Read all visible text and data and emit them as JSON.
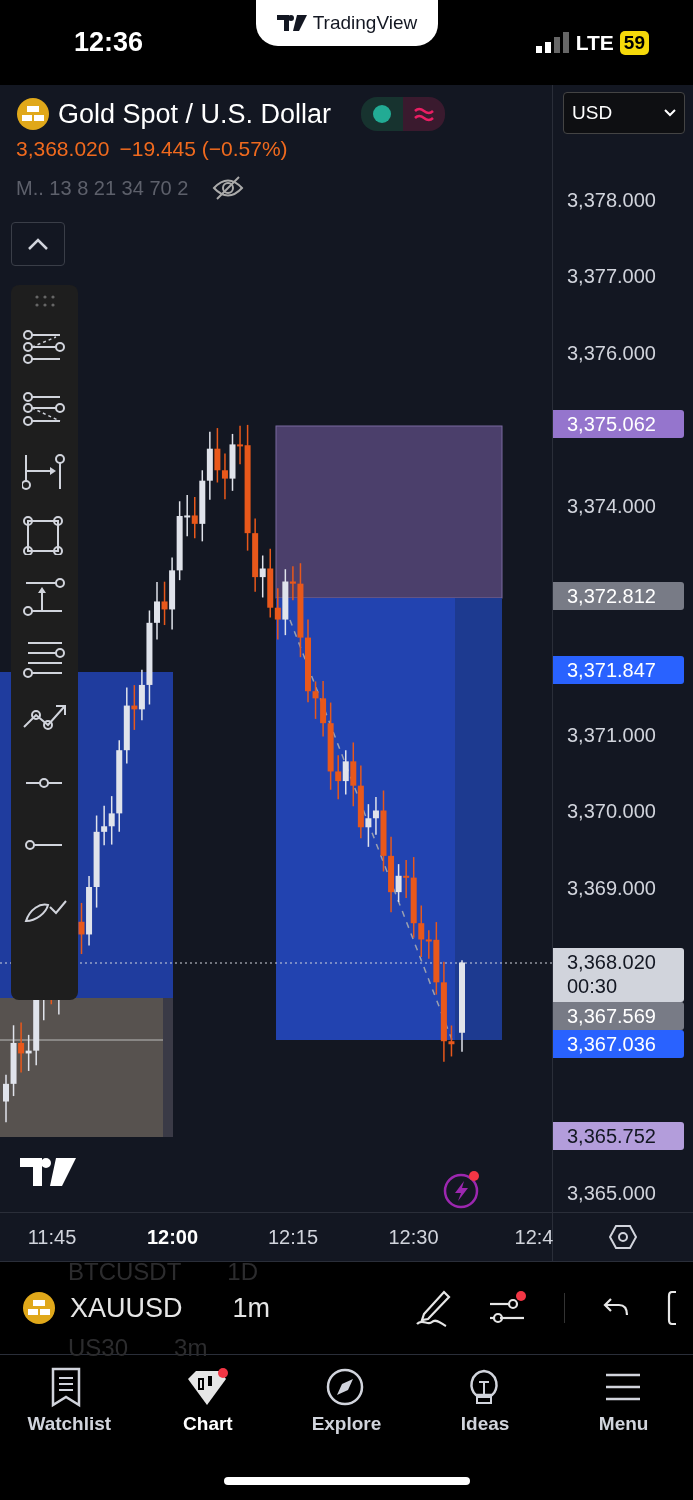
{
  "status_bar": {
    "time": "12:36",
    "network": "LTE",
    "battery": "59"
  },
  "app_pill": {
    "label": "TradingView"
  },
  "legend": {
    "title": "Gold Spot / U.S. Dollar",
    "price": "3,368.020",
    "change": "−19.445 (−0.57%)",
    "indicators": "M.. 13 8 21 34 70 2"
  },
  "currency": "USD",
  "price_axis": [
    {
      "text": "3,378.000",
      "kind": "tick"
    },
    {
      "text": "3,377.000",
      "kind": "tick"
    },
    {
      "text": "3,376.000",
      "kind": "tick"
    },
    {
      "text": "3,375.062",
      "kind": "tag",
      "color": "#9575cd"
    },
    {
      "text": "3,374.000",
      "kind": "tick"
    },
    {
      "text": "3,372.812",
      "kind": "tag",
      "color": "#787b86"
    },
    {
      "text": "3,371.847",
      "kind": "tag",
      "color": "#2962ff"
    },
    {
      "text": "3,371.000",
      "kind": "tick"
    },
    {
      "text": "3,370.000",
      "kind": "tick"
    },
    {
      "text": "3,369.000",
      "kind": "tick"
    },
    {
      "text": "3,368.020",
      "kind": "tag",
      "color": "#d1d4dc",
      "countdown": "00:30"
    },
    {
      "text": "3,367.569",
      "kind": "tag",
      "color": "#787b86"
    },
    {
      "text": "3,367.036",
      "kind": "tag",
      "color": "#2962ff"
    },
    {
      "text": "3,365.752",
      "kind": "tag",
      "color": "#b39ddb"
    },
    {
      "text": "3,365.000",
      "kind": "tick"
    }
  ],
  "time_axis": [
    {
      "text": "11:45",
      "emphasized": false
    },
    {
      "text": "12:00",
      "emphasized": true
    },
    {
      "text": "12:15",
      "emphasized": false
    },
    {
      "text": "12:30",
      "emphasized": false
    },
    {
      "text": "12:4",
      "emphasized": false
    }
  ],
  "symbol_bar": {
    "symbol": "XAUUSD",
    "interval": "1m",
    "settings_notification": true,
    "faded_rows": [
      {
        "symbol": "BTCUSDT",
        "interval": "1D"
      },
      {
        "symbol": "US30",
        "interval": "3m"
      }
    ]
  },
  "nav": [
    {
      "label": "Watchlist",
      "selected": false,
      "badge": false
    },
    {
      "label": "Chart",
      "selected": true,
      "badge": true
    },
    {
      "label": "Explore",
      "selected": false,
      "badge": false
    },
    {
      "label": "Ideas",
      "selected": false,
      "badge": false
    },
    {
      "label": "Menu",
      "selected": false,
      "badge": false
    }
  ]
}
